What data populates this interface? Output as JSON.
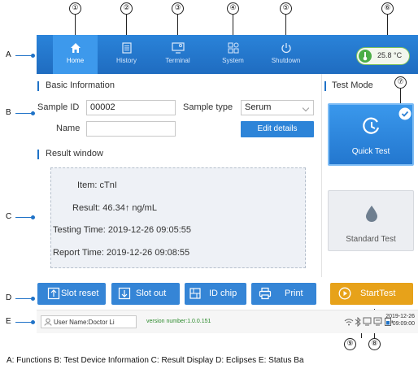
{
  "callouts": [
    "①",
    "②",
    "③",
    "④",
    "⑤",
    "⑥",
    "⑦",
    "⑧",
    "⑨"
  ],
  "row_labels": {
    "a": "A",
    "b": "B",
    "c": "C",
    "d": "D",
    "e": "E"
  },
  "nav": {
    "home": "Home",
    "history": "History",
    "terminal": "Terminal",
    "system": "System",
    "shutdown": "Shutdown"
  },
  "temperature": "25.8 °C",
  "basic_info": {
    "heading": "Basic Information",
    "sample_id_label": "Sample ID",
    "sample_id_value": "00002",
    "sample_type_label": "Sample type",
    "sample_type_value": "Serum",
    "name_label": "Name",
    "name_value": "",
    "edit_label": "Edit details"
  },
  "test_mode": {
    "heading": "Test Mode",
    "quick": "Quick Test",
    "standard": "Standard Test"
  },
  "result": {
    "heading": "Result window",
    "item": "Item:  cTnI",
    "result": "Result: 46.34↑ ng/mL",
    "testing_time": "Testing Time: 2019-12-26 09:05:55",
    "report_time": "Report Time: 2019-12-26 09:08:55"
  },
  "buttons": {
    "slot_reset": "Slot reset",
    "slot_out": "Slot out",
    "id_chip": "ID chip",
    "print": "Print",
    "start": "StartTest"
  },
  "status": {
    "user": "User Name:Doctor Li",
    "version": "version number:1.0.0.151",
    "date": "2019-12-26",
    "time": "09:09:00"
  },
  "legend": "A: Functions     B: Test Device Information     C: Result Display     D: Eclipses     E: Status Ba",
  "colors": {
    "primary": "#1f72c7",
    "accent": "#e7a21a",
    "temp": "#4cae47"
  }
}
